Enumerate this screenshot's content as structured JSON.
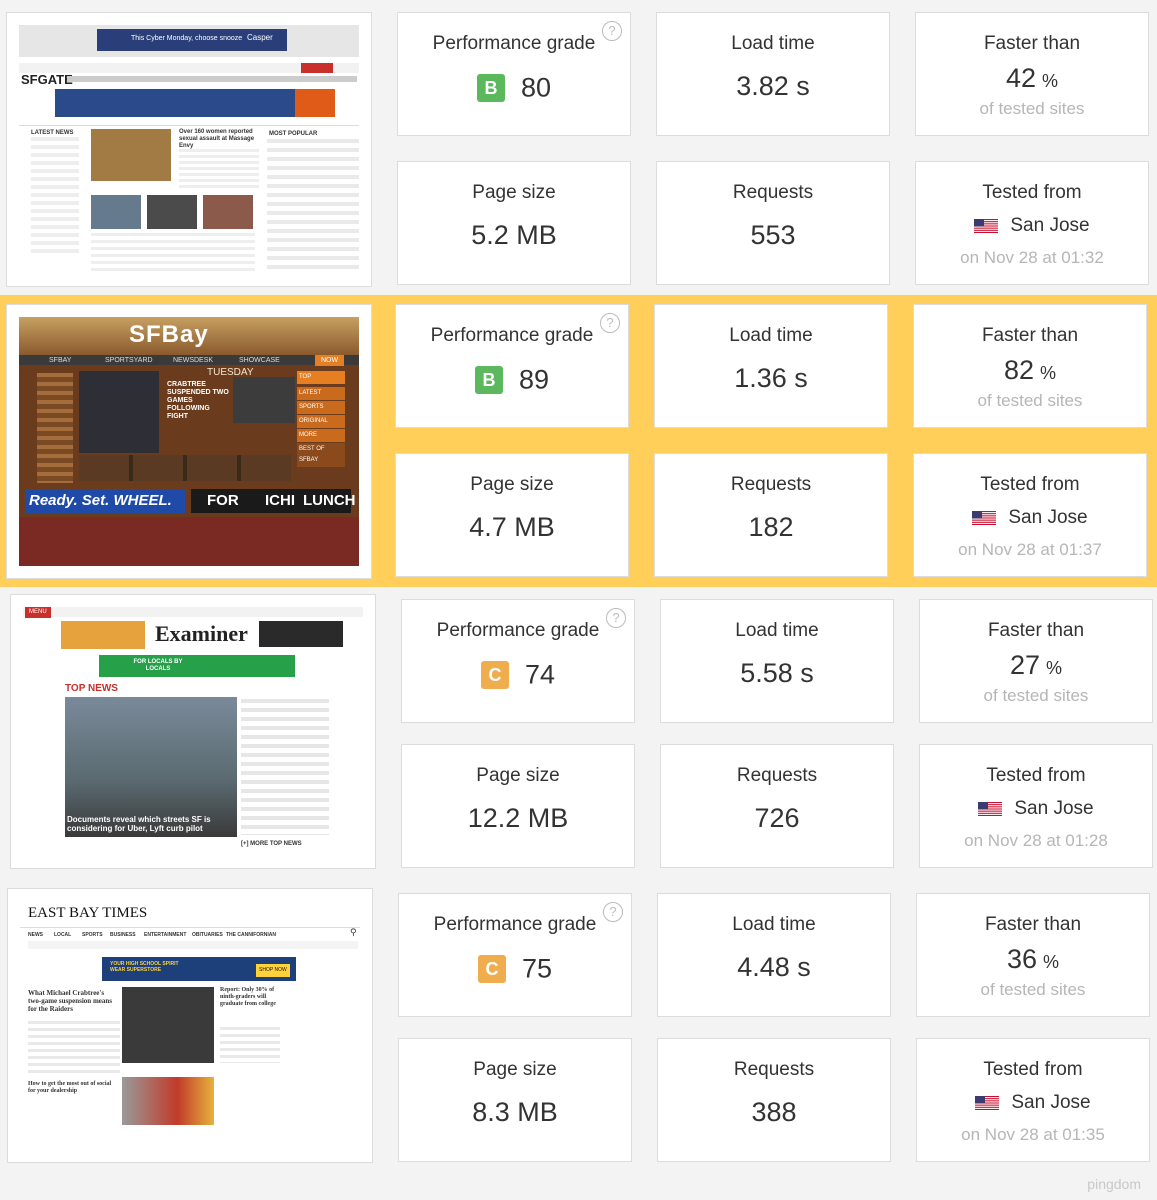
{
  "labels": {
    "performance_grade": "Performance grade",
    "load_time": "Load time",
    "faster_than": "Faster than",
    "of_tested_sites": "of tested sites",
    "page_size": "Page size",
    "requests": "Requests",
    "tested_from": "Tested from",
    "help": "?"
  },
  "results": [
    {
      "site": {
        "masthead": "SFGATE",
        "banner": "This Cyber Monday, choose snooze",
        "banner_brand": "Casper",
        "section": "LATEST NEWS",
        "headline": "Over 160 women reported sexual assault at Massage Envy",
        "sidebar": "MOST POPULAR"
      },
      "grade_letter": "B",
      "grade_color": "#5cb85c",
      "grade_value": "80",
      "load_time": "3.82 s",
      "faster_than": "42",
      "percent": "%",
      "page_size": "5.2 MB",
      "requests": "553",
      "location": "San Jose",
      "date": "on Nov 28 at 01:32"
    },
    {
      "site": {
        "masthead": "SFBay",
        "tagline": "TUESDAY",
        "headline": "CRABTREE SUSPENDED TWO GAMES FOLLOWING FIGHT",
        "ad": "Ready. Set. WHEEL.",
        "ad2": "FOR",
        "ad3": "ICHI",
        "ad4": "LUNCH",
        "nav": [
          "SFBAY",
          "SPORTSYARD",
          "NEWSDESK",
          "SHOWCASE",
          "NOW"
        ],
        "side": [
          "TOP",
          "LATEST",
          "SPORTS",
          "ORIGINAL",
          "MORE",
          "BEST OF SFBAY"
        ]
      },
      "grade_letter": "B",
      "grade_color": "#5cb85c",
      "grade_value": "89",
      "load_time": "1.36 s",
      "faster_than": "82",
      "percent": "%",
      "page_size": "4.7 MB",
      "requests": "182",
      "location": "San Jose",
      "date": "on Nov 28 at 01:37"
    },
    {
      "site": {
        "masthead": "Examiner",
        "menu": "MENU",
        "promo": "FOR LOCALS BY LOCALS",
        "section": "TOP NEWS",
        "caption": "Documents reveal which streets SF is considering for Uber, Lyft curb pilot",
        "more": "[+] MORE TOP NEWS"
      },
      "grade_letter": "C",
      "grade_color": "#f0ad4e",
      "grade_value": "74",
      "load_time": "5.58 s",
      "faster_than": "27",
      "percent": "%",
      "page_size": "12.2 MB",
      "requests": "726",
      "location": "San Jose",
      "date": "on Nov 28 at 01:28"
    },
    {
      "site": {
        "masthead": "EAST BAY TIMES",
        "nav": [
          "NEWS",
          "LOCAL",
          "SPORTS",
          "BUSINESS",
          "ENTERTAINMENT",
          "OBITUARIES",
          "THE CANNIFORNIAN"
        ],
        "ad": "YOUR HIGH SCHOOL SPIRIT WEAR SUPERSTORE",
        "ad_btn": "SHOP NOW",
        "headline": "What Michael Crabtree's two-game suspension means for the Raiders",
        "side": "Report: Only 30% of ninth-graders will graduate from college",
        "sponsored": "How to get the most out of social for your dealership"
      },
      "grade_letter": "C",
      "grade_color": "#f0ad4e",
      "grade_value": "75",
      "load_time": "4.48 s",
      "faster_than": "36",
      "percent": "%",
      "page_size": "8.3 MB",
      "requests": "388",
      "location": "San Jose",
      "date": "on Nov 28 at 01:35"
    }
  ],
  "footer": {
    "logo": "pingdom"
  }
}
